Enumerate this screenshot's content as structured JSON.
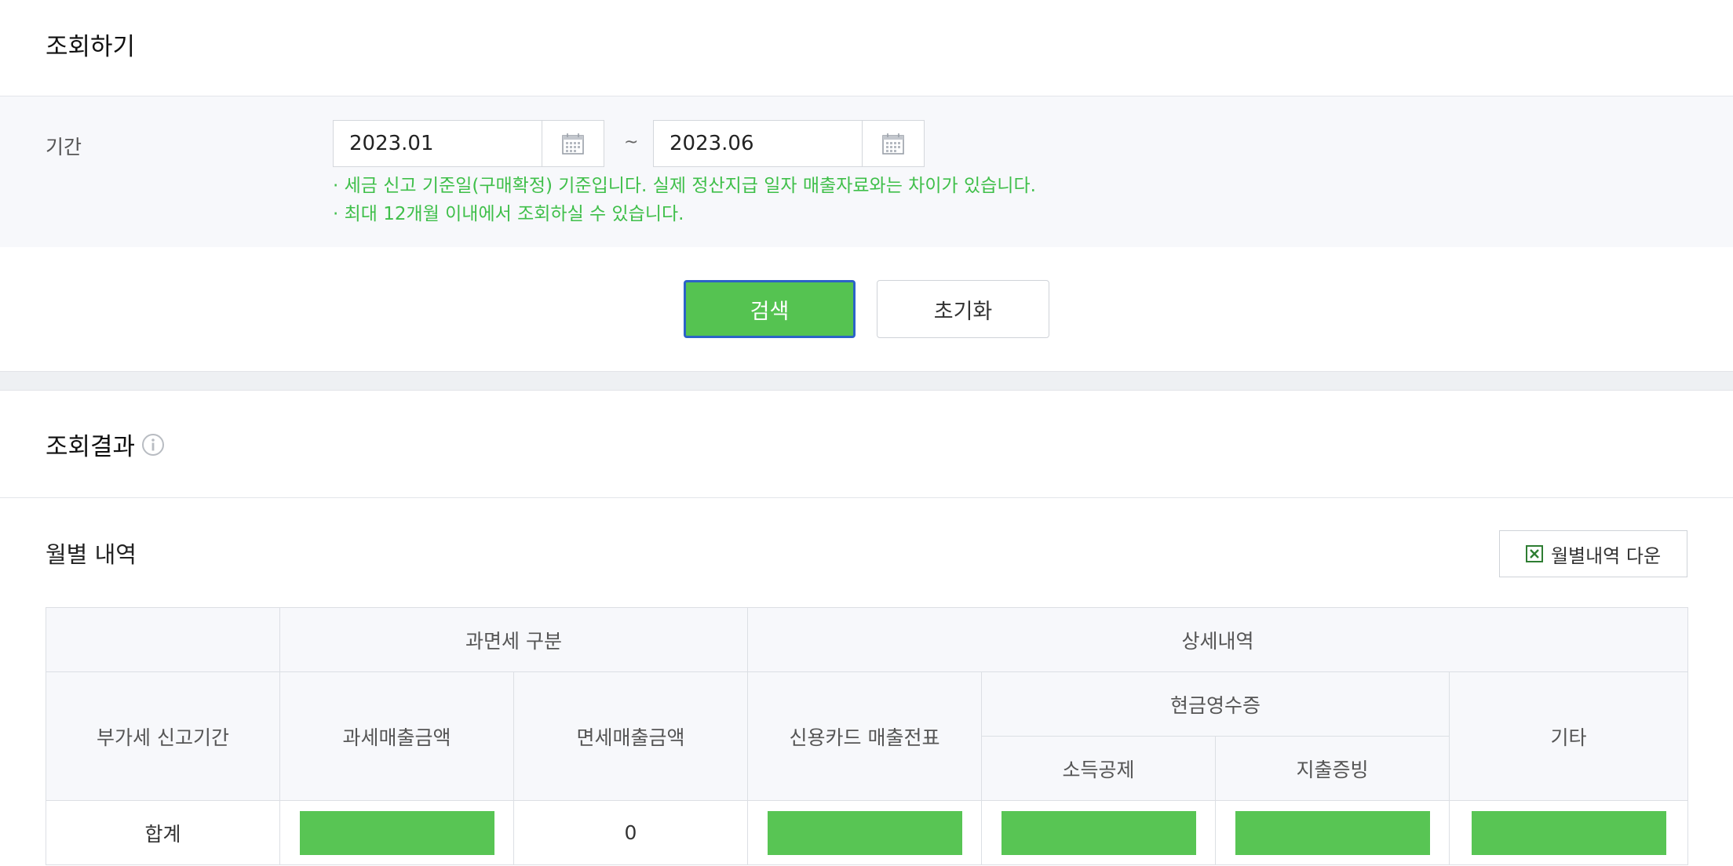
{
  "search": {
    "title": "조회하기",
    "period_label": "기간",
    "start_date": "2023.01",
    "end_date": "2023.06",
    "tilde": "~",
    "notes": [
      "· 세금 신고 기준일(구매확정) 기준입니다. 실제 정산지급 일자 매출자료와는 차이가 있습니다.",
      "· 최대 12개월 이내에서 조회하실 수 있습니다."
    ],
    "search_button": "검색",
    "reset_button": "초기화"
  },
  "result": {
    "title": "조회결과",
    "monthly_title": "월별 내역",
    "download_button": "월별내역 다운"
  },
  "table": {
    "group_tax": "과면세 구분",
    "group_detail": "상세내역",
    "col_period": "부가세 신고기간",
    "col_taxable": "과세매출금액",
    "col_taxfree": "면세매출금액",
    "col_card": "신용카드 매출전표",
    "col_cash_receipt": "현금영수증",
    "col_income_deduction": "소득공제",
    "col_expense_proof": "지출증빙",
    "col_other": "기타",
    "row_total_label": "합계",
    "row_total_taxfree": "0"
  },
  "colors": {
    "accent_green": "#55c351",
    "note_green": "#3fbf4a",
    "focus_blue": "#2c63c7"
  },
  "icons": {
    "calendar": "calendar-icon",
    "info": "info-icon",
    "excel": "excel-icon"
  }
}
